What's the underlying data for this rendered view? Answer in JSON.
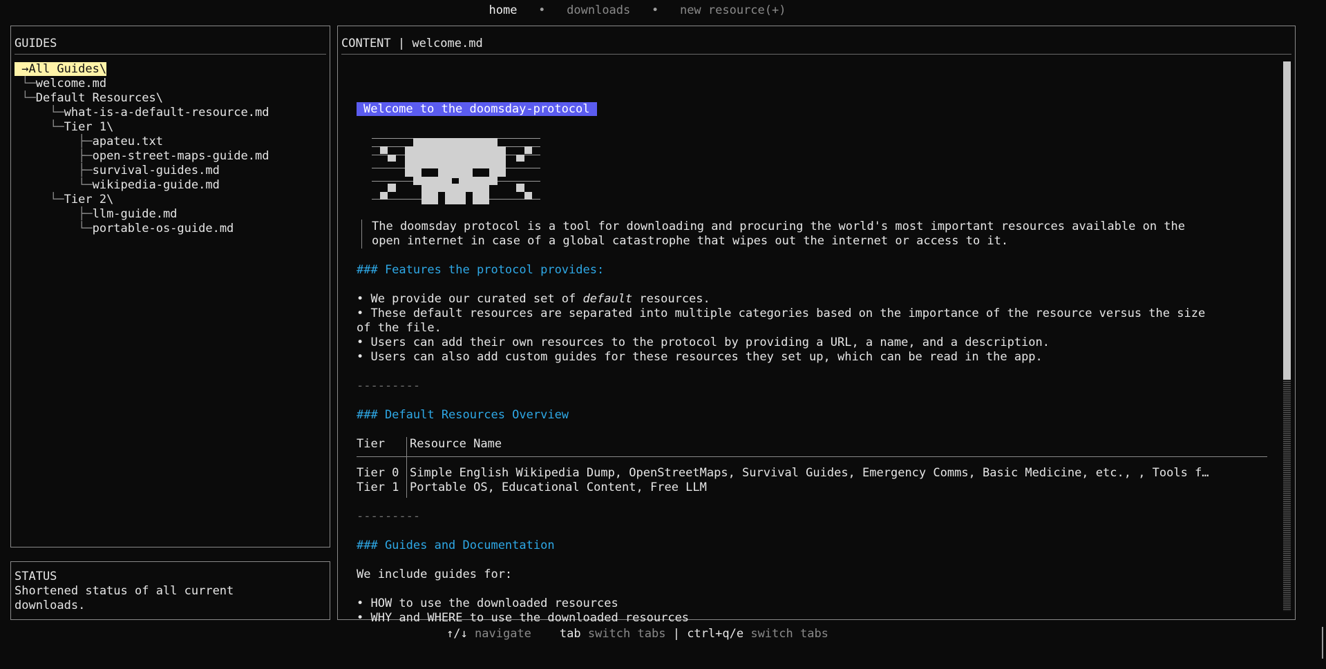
{
  "nav": {
    "tabs": [
      {
        "label": "home"
      },
      {
        "label": "downloads"
      },
      {
        "label": "new resource(+)"
      }
    ],
    "separator": "•"
  },
  "guides": {
    "title": "GUIDES",
    "tree": [
      {
        "branch": "",
        "label": "→All Guides\\"
      },
      {
        "branch": " └─",
        "label": "welcome.md"
      },
      {
        "branch": " └─",
        "label": "Default Resources\\"
      },
      {
        "branch": "     └─",
        "label": "what-is-a-default-resource.md"
      },
      {
        "branch": "     └─",
        "label": "Tier 1\\"
      },
      {
        "branch": "         ├─",
        "label": "apateu.txt"
      },
      {
        "branch": "         ├─",
        "label": "open-street-maps-guide.md"
      },
      {
        "branch": "         ├─",
        "label": "survival-guides.md"
      },
      {
        "branch": "         └─",
        "label": "wikipedia-guide.md"
      },
      {
        "branch": "     └─",
        "label": "Tier 2\\"
      },
      {
        "branch": "         ├─",
        "label": "llm-guide.md"
      },
      {
        "branch": "         └─",
        "label": "portable-os-guide.md"
      }
    ]
  },
  "status": {
    "title": "STATUS",
    "line1": "Shortened status of all current",
    "line2": "downloads."
  },
  "content": {
    "title": "CONTENT | welcome.md",
    "heading": "Welcome to the doomsday-protocol",
    "quote_line1": "The doomsday protocol is a tool for downloading and procuring the world's most important resources available on the",
    "quote_line2": "open internet in case of a global catastrophe that wipes out the internet or access to it.",
    "features_heading": "### Features the protocol provides:",
    "bullet1_pre": "• We provide our curated set of ",
    "bullet1_em": "default",
    "bullet1_post": " resources.",
    "bullet2a": "• These default resources are separated into multiple categories based on the importance of the resource versus the size",
    "bullet2b": "of the file.",
    "bullet3": "• Users can add their own resources to the protocol by providing a URL, a name, and a description.",
    "bullet4": "• Users can also add custom guides for these resources they set up, which can be read in the app.",
    "rule": "---------",
    "overview_heading": "### Default Resources Overview",
    "table": {
      "headers": [
        "Tier",
        "Resource Name"
      ],
      "rows": [
        [
          "Tier 0",
          "Simple English Wikipedia Dump, OpenStreetMaps, Survival Guides, Emergency Comms, Basic Medicine, etc., , Tools f…"
        ],
        [
          "Tier 1",
          "Portable OS, Educational Content, Free LLM"
        ]
      ]
    },
    "guides_heading": "### Guides and Documentation",
    "guides_intro": "We include guides for:",
    "guides_bullet1": "• HOW to use the downloaded resources",
    "guides_bullet2": "• WHY and WHERE to use the downloaded resources"
  },
  "help": {
    "nav_key": "↑/↓",
    "nav_desc": "navigate",
    "tab_key": "tab",
    "tab_desc": "switch tabs",
    "divider": "|",
    "ctrl_key": "ctrl+q/e",
    "ctrl_desc": "switch tabs"
  }
}
